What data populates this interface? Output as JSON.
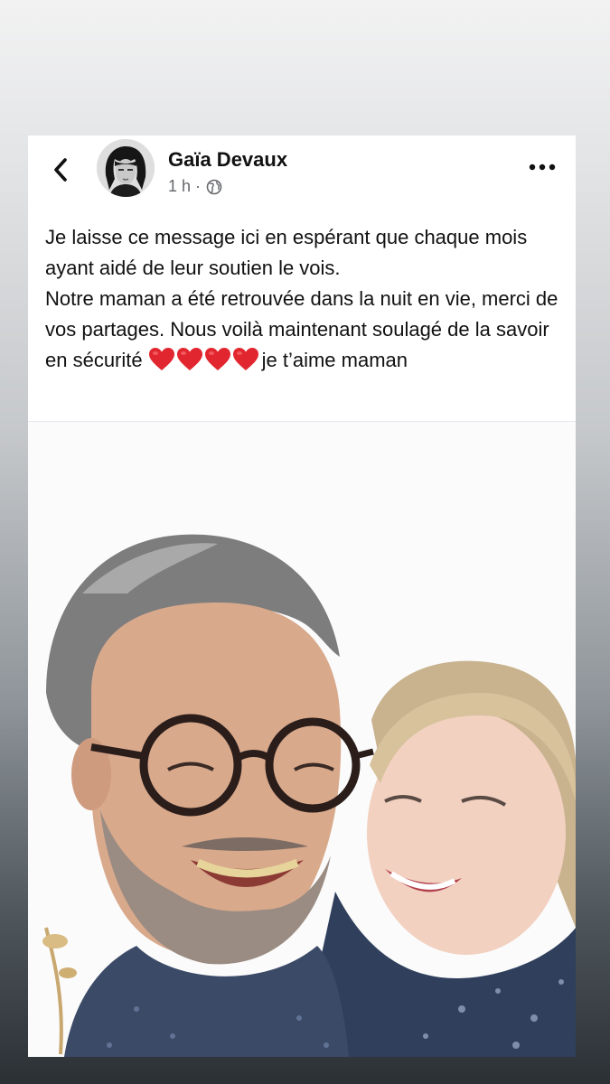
{
  "post": {
    "author": "Gaïa Devaux",
    "timestamp": "1 h",
    "separator": "·",
    "audience_icon": "globe-icon",
    "text_line1": "Je laisse ce message ici en espérant que chaque mois ayant aidé de leur soutien le vois.",
    "text_line2": "Notre maman a été retrouvée dans la nuit en vie, merci de vos partages. Nous voilà maintenant soulagé de la savoir en sécurité",
    "emoji": "❤️❤️❤️❤️",
    "text_line2_end": "je t’aime maman"
  },
  "icons": {
    "back": "chevron-left-icon",
    "more": "more-horizontal-icon"
  },
  "colors": {
    "heart": "#e2262f",
    "meta_text": "#65676b",
    "text": "#111111"
  }
}
